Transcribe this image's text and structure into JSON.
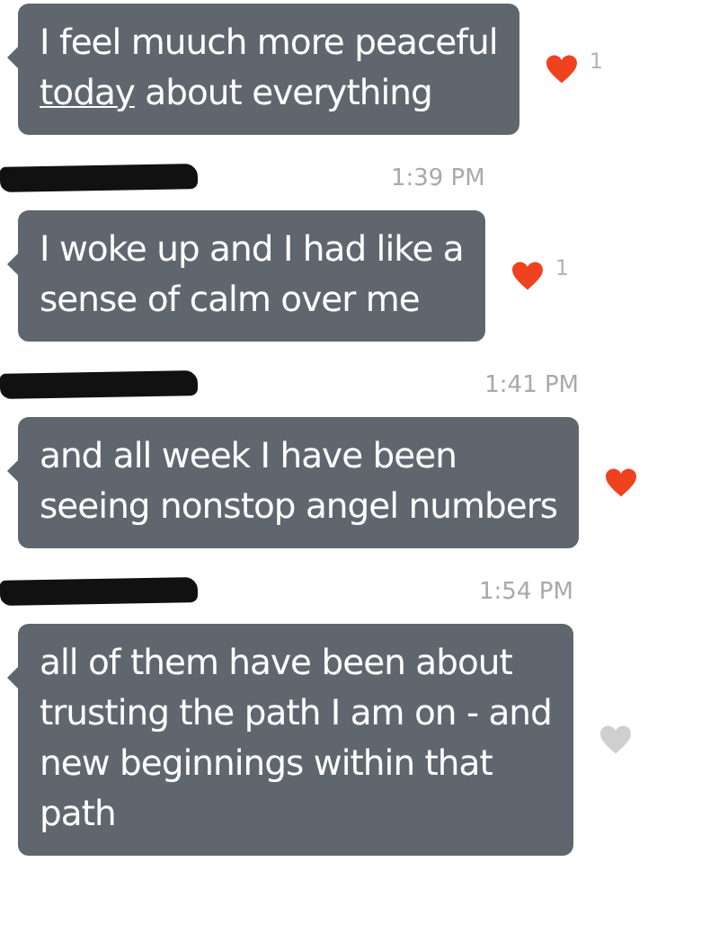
{
  "messages": [
    {
      "parts": [
        {
          "text": "I feel muuch more peaceful\n",
          "underline": false
        },
        {
          "text": "today",
          "underline": true
        },
        {
          "text": " about everything",
          "underline": false
        }
      ],
      "liked": true,
      "likes": "1"
    },
    {
      "sender_redacted": true,
      "time": "1:39 PM",
      "parts": [
        {
          "text": "I woke up and I had like a\nsense of calm over me",
          "underline": false
        }
      ],
      "liked": true,
      "likes": "1"
    },
    {
      "sender_redacted": true,
      "time": "1:41 PM",
      "parts": [
        {
          "text": "and all week I have been\nseeing nonstop angel numbers",
          "underline": false
        }
      ],
      "liked": true
    },
    {
      "sender_redacted": true,
      "time": "1:54 PM",
      "parts": [
        {
          "text": "all of them have been about\ntrusting the path I am on - and\nnew beginnings within that\npath",
          "underline": false
        }
      ],
      "liked": false
    }
  ]
}
